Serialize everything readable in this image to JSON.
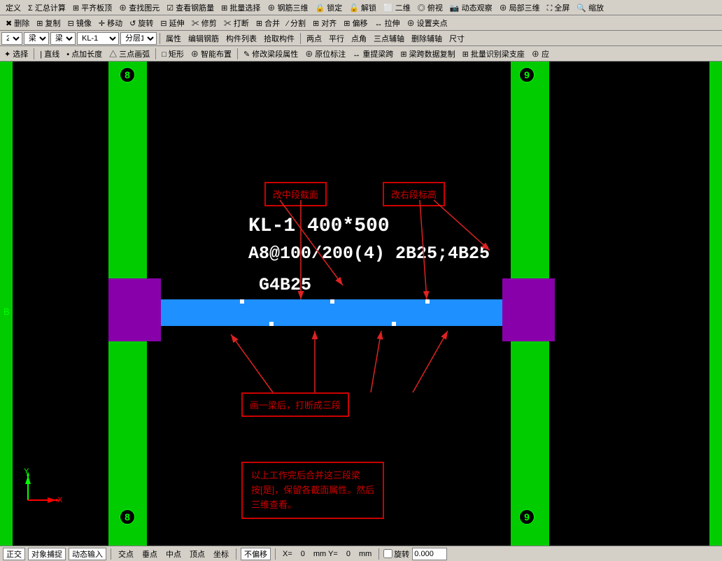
{
  "menubar1": {
    "items": [
      {
        "label": "定义",
        "icon": ""
      },
      {
        "label": "Σ 汇总计算",
        "icon": ""
      },
      {
        "label": "⊞ 平齐板顶",
        "icon": ""
      },
      {
        "label": "⊕ 查找图元",
        "icon": ""
      },
      {
        "label": "☑ 查看钢筋量",
        "icon": ""
      },
      {
        "label": "⊞ 批量选择",
        "icon": ""
      },
      {
        "label": "⊕ 钢筋三维",
        "icon": ""
      },
      {
        "label": "🔒 锁定",
        "icon": ""
      },
      {
        "label": "🔓 解锁",
        "icon": ""
      },
      {
        "label": "⬜ 二维",
        "icon": ""
      },
      {
        "label": "◎ 俯视",
        "icon": ""
      },
      {
        "label": "📷 动态观察",
        "icon": ""
      },
      {
        "label": "⊕ 局部三维",
        "icon": ""
      },
      {
        "label": "⛶ 全屏",
        "icon": ""
      },
      {
        "label": "🔍 缩放",
        "icon": ""
      }
    ]
  },
  "menubar2": {
    "items": [
      {
        "label": "✖ 删除"
      },
      {
        "label": "⊞ 复制"
      },
      {
        "label": "⊟ 镜像"
      },
      {
        "label": "✛ 移动"
      },
      {
        "label": "↺ 旋转"
      },
      {
        "label": "⊟ 延伸"
      },
      {
        "label": "✂ 修剪"
      },
      {
        "label": "✂ 打断"
      },
      {
        "label": "⊞ 合并"
      },
      {
        "label": "∕ 分割"
      },
      {
        "label": "⊞ 对齐"
      },
      {
        "label": "⊞ 偏移"
      },
      {
        "label": "↔ 拉伸"
      },
      {
        "label": "⊕ 设置夹点"
      }
    ]
  },
  "menubar3": {
    "layer_num": "2",
    "beam_type": "梁",
    "beam_type2": "梁",
    "beam_id": "KL-1",
    "layer": "分层1",
    "buttons": [
      {
        "label": "属性"
      },
      {
        "label": "编辑钢筋"
      },
      {
        "label": "构件列表"
      },
      {
        "label": "拾取构件"
      },
      {
        "label": "两点"
      },
      {
        "label": "平行"
      },
      {
        "label": "点角"
      },
      {
        "label": "三点辅轴"
      },
      {
        "label": "删除辅轴"
      },
      {
        "label": "尺寸"
      }
    ]
  },
  "menubar4": {
    "items": [
      {
        "label": "✦ 选择"
      },
      {
        "label": "| 直线"
      },
      {
        "label": "• 点加长度"
      },
      {
        "label": "△ 三点画弧"
      },
      {
        "label": "□ 矩形"
      },
      {
        "label": "⊕ 智能布置"
      },
      {
        "label": "✎ 修改梁段属性"
      },
      {
        "label": "⊕ 原位标注"
      },
      {
        "label": "↔ 重提梁跨"
      },
      {
        "label": "⊞ 梁跨数据复制"
      },
      {
        "label": "⊞ 批量识别梁支座"
      },
      {
        "label": "⊕ 应"
      }
    ]
  },
  "canvas": {
    "beam_label_line1": "KL-1 400*500",
    "beam_label_line2": "A8@100/200(4) 2B25;4B25",
    "beam_label_line3": "G4B25",
    "annotation1": "改中段截面",
    "annotation2": "改右段标高",
    "annotation3": "画一梁后，打断成三段",
    "info_box_text": "以上工作完后合并这三段梁\n按[是]，保留各截面属性。然后\n三维查看。",
    "grid_num_tl": "8",
    "grid_num_tr": "9",
    "grid_num_bl": "8",
    "grid_num_br": "9",
    "axis_label": "B"
  },
  "statusbar": {
    "items": [
      {
        "label": "正交",
        "active": true
      },
      {
        "label": "对象捕捉",
        "active": true
      },
      {
        "label": "动态输入",
        "active": true
      },
      {
        "label": "交点",
        "active": false
      },
      {
        "label": "垂点",
        "active": false
      },
      {
        "label": "中点",
        "active": false
      },
      {
        "label": "顶点",
        "active": false
      },
      {
        "label": "坐标",
        "active": false
      },
      {
        "label": "不偏移",
        "active": true
      }
    ],
    "coord_x": "X=",
    "coord_val_x": "0",
    "coord_y": "mm  Y=",
    "coord_val_y": "0",
    "coord_unit": "mm",
    "rotate_label": "旋转",
    "rotate_val": "0.000"
  }
}
